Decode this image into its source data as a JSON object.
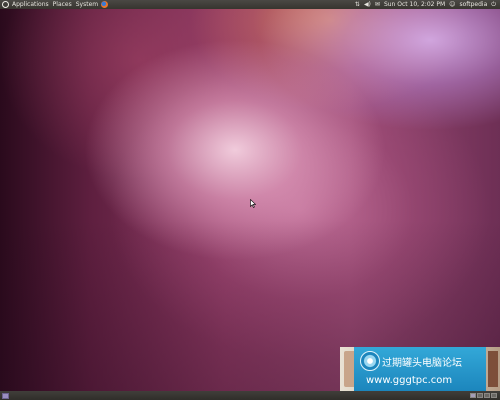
{
  "top_panel": {
    "menus": [
      "Applications",
      "Places",
      "System"
    ],
    "clock": "Sun Oct 10,  2:02 PM",
    "user": "softpedia",
    "icons": [
      "ubuntu-logo",
      "firefox-logo",
      "network-icon",
      "volume-icon",
      "mail-icon",
      "user-icon",
      "power-icon"
    ]
  },
  "desktop": {
    "wallpaper_colors": [
      "#2a0a1c",
      "#8d3a63",
      "#f5d2e1",
      "#d7afeb",
      "#f0a05a"
    ]
  },
  "bottom_panel": {
    "icons": [
      "show-desktop-icon",
      "workspace-switcher"
    ]
  },
  "watermark": {
    "title": "过期罐头电脑论坛",
    "url": "www.gggtpc.com"
  }
}
